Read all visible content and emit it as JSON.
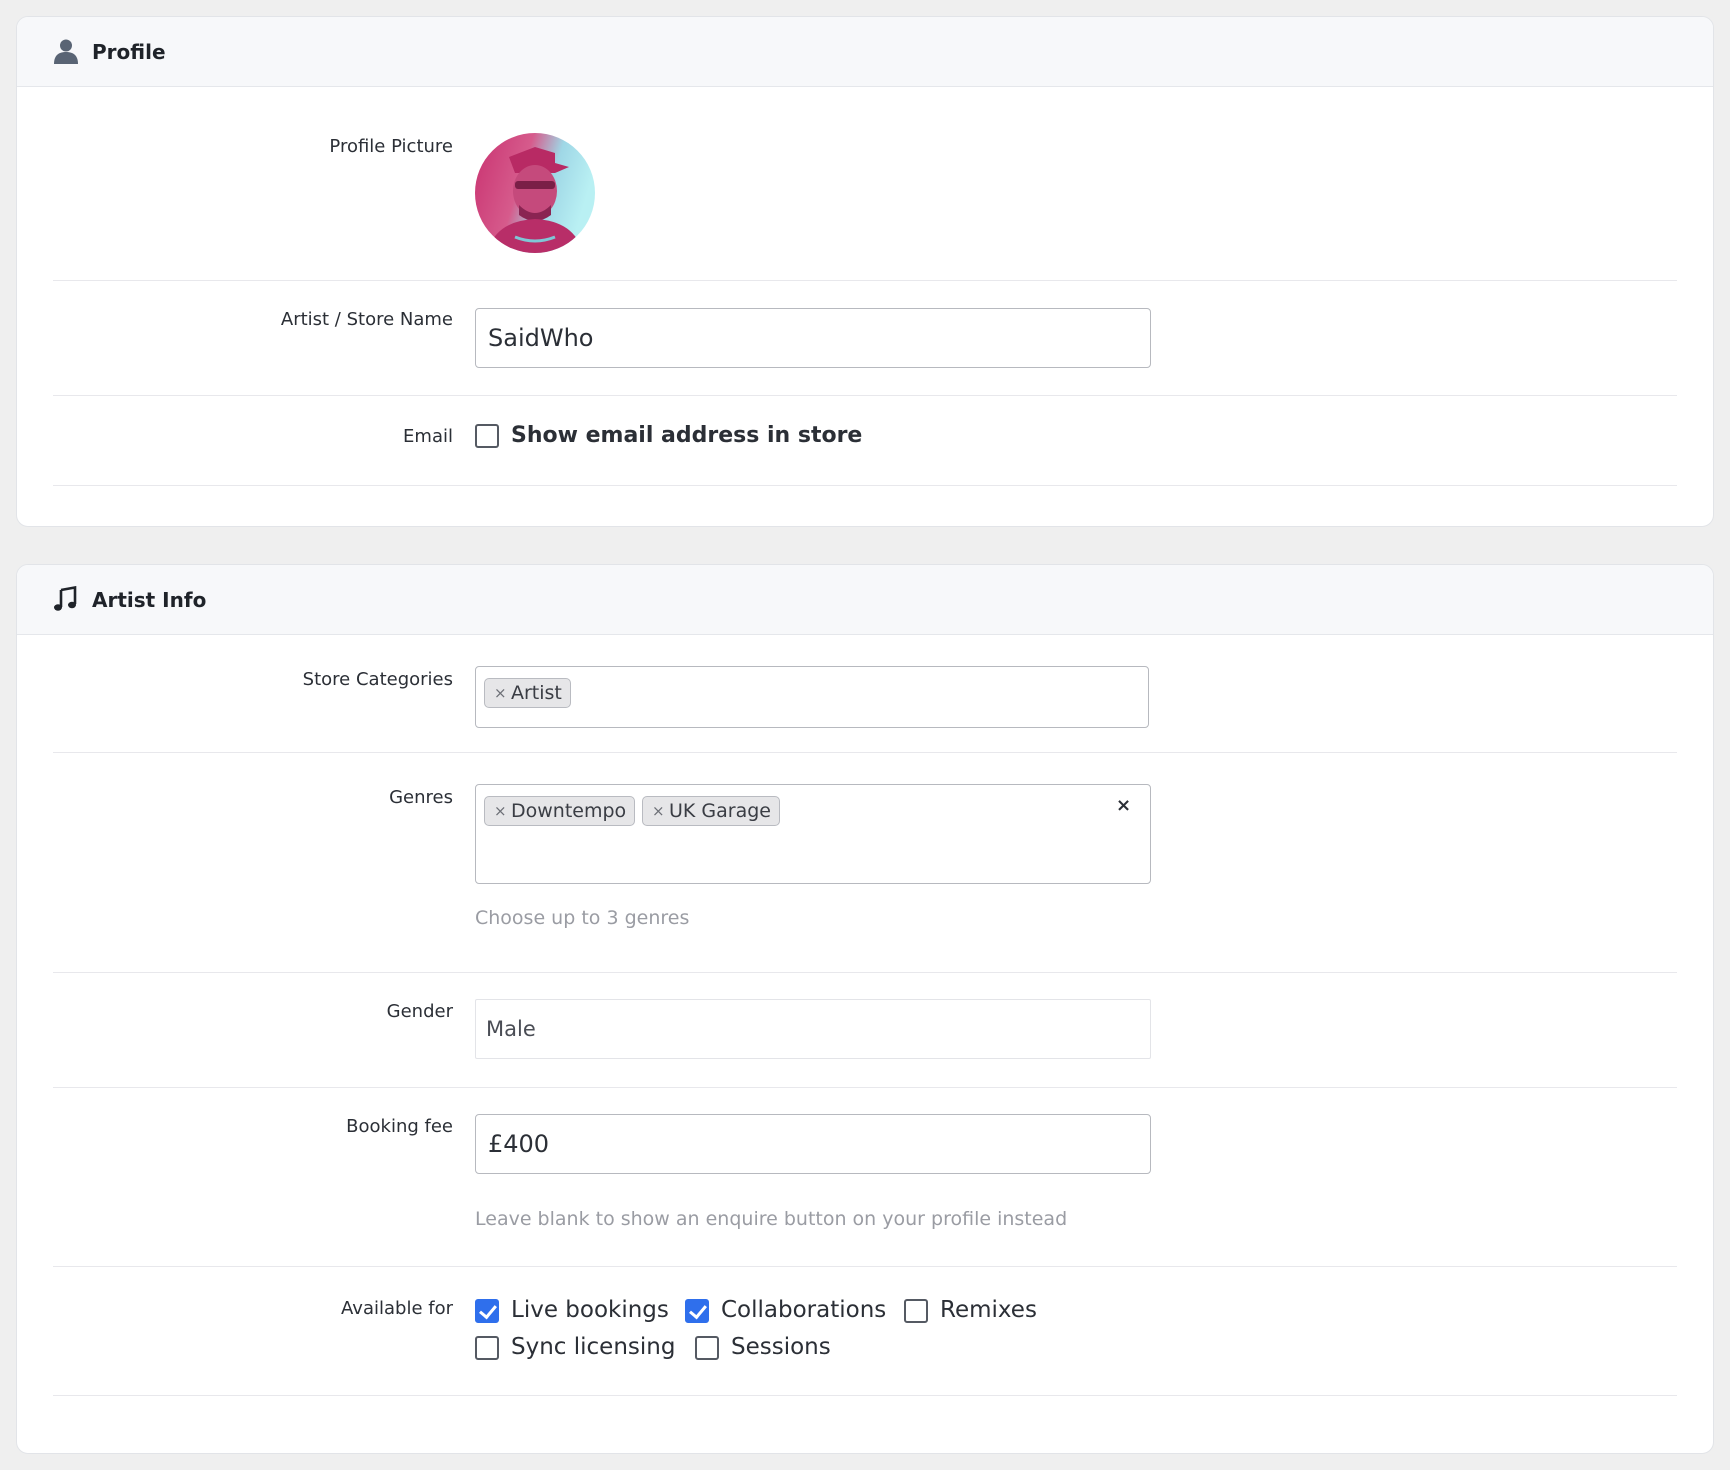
{
  "profile": {
    "title": "Profile",
    "icon": "user-icon",
    "picture_label": "Profile Picture",
    "name_label": "Artist / Store Name",
    "name_value": "SaidWho",
    "email_label": "Email",
    "show_email_label": "Show email address in store",
    "show_email_checked": false
  },
  "artist": {
    "title": "Artist Info",
    "icon": "music-note-icon",
    "categories_label": "Store Categories",
    "categories": [
      "Artist"
    ],
    "genres_label": "Genres",
    "genres": [
      "Downtempo",
      "UK Garage"
    ],
    "genres_clear": "×",
    "genres_help": "Choose up to 3 genres",
    "gender_label": "Gender",
    "gender_value": "Male",
    "fee_label": "Booking fee",
    "fee_value": "£400",
    "fee_help": "Leave blank to show an enquire button on your profile instead",
    "available_label": "Available for",
    "available": [
      {
        "label": "Live bookings",
        "checked": true
      },
      {
        "label": "Collaborations",
        "checked": true
      },
      {
        "label": "Remixes",
        "checked": false
      },
      {
        "label": "Sync licensing",
        "checked": false
      },
      {
        "label": "Sessions",
        "checked": false
      }
    ]
  },
  "tag_remove": "×",
  "colors": {
    "accent": "#2f6fec",
    "avatar_pink": "#d0336f",
    "avatar_cyan": "#a8e6ee"
  }
}
